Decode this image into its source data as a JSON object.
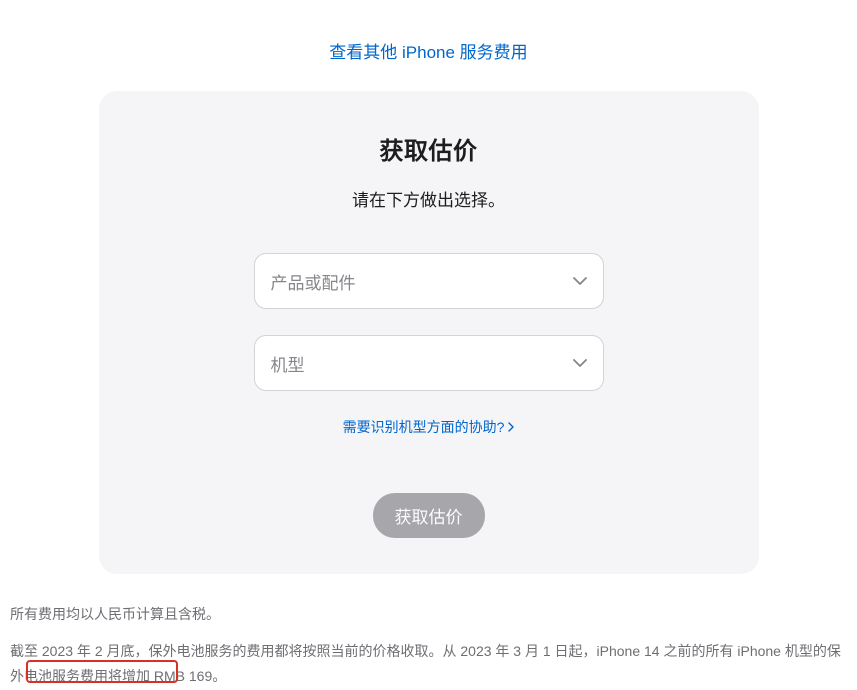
{
  "top_link": "查看其他 iPhone 服务费用",
  "card": {
    "title": "获取估价",
    "subtitle": "请在下方做出选择。",
    "select_product_placeholder": "产品或配件",
    "select_model_placeholder": "机型",
    "help_link": "需要识别机型方面的协助?",
    "button": "获取估价"
  },
  "footer": {
    "line1": "所有费用均以人民币计算且含税。",
    "line2": "截至 2023 年 2 月底，保外电池服务的费用都将按照当前的价格收取。从 2023 年 3 月 1 日起，iPhone 14 之前的所有 iPhone 机型的保外电池服务费用将增加 RMB 169。"
  }
}
